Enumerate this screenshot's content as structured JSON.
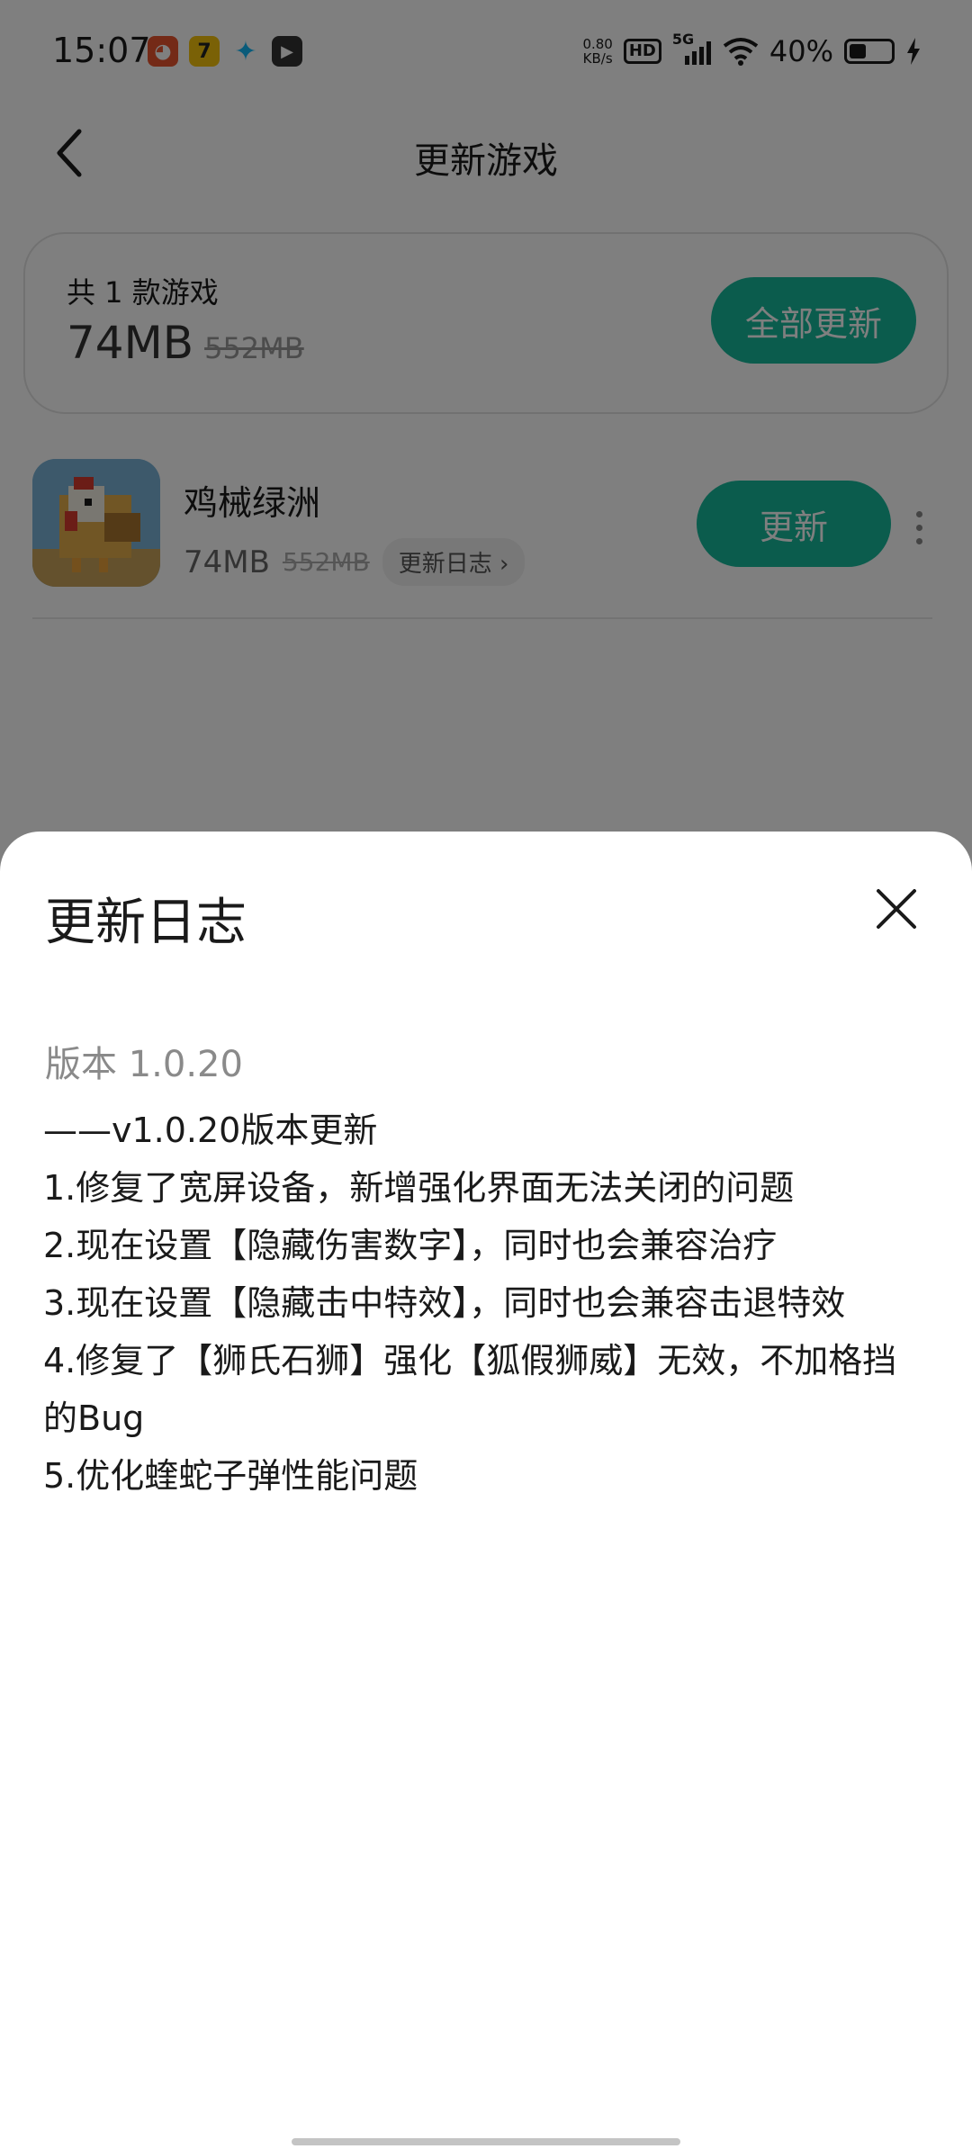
{
  "status_bar": {
    "time": "15:07",
    "apps": [
      {
        "icon": "red-app-icon",
        "glyph": "◕",
        "color": "#e8552e"
      },
      {
        "icon": "game-7-app-icon",
        "glyph": "7",
        "color": "#f4c20d"
      },
      {
        "icon": "qq-icon",
        "glyph": "✦",
        "color": "#12b7f5"
      },
      {
        "icon": "video-play-icon",
        "glyph": "▶",
        "color": "#333333"
      }
    ],
    "net_speed_value": "0.80",
    "net_speed_unit": "KB/s",
    "hd": "HD",
    "signal": "5G",
    "battery": "40%",
    "battery_level": 0.4
  },
  "header": {
    "title": "更新游戏"
  },
  "summary": {
    "count_text": "共 1 款游戏",
    "size_new": "74MB",
    "size_old": "552MB",
    "update_all_label": "全部更新"
  },
  "game": {
    "name": "鸡械绿洲",
    "size_new": "74MB",
    "size_old": "552MB",
    "changelog_link": "更新日志 ›",
    "update_label": "更新"
  },
  "sheet": {
    "title": "更新日志",
    "version": "版本 1.0.20",
    "lines": [
      "——v1.0.20版本更新",
      "1.修复了宽屏设备，新增强化界面无法关闭的问题",
      "2.现在设置【隐藏伤害数字】，同时也会兼容治疗",
      "3.现在设置【隐藏击中特效】，同时也会兼容击退特效",
      "4.修复了【狮氏石狮】强化【狐假狮威】无效，不加格挡的Bug",
      "5.优化蝰蛇子弹性能问题"
    ]
  },
  "colors": {
    "accent": "#17b89b",
    "scrim": "rgba(0,0,0,0.5)"
  }
}
